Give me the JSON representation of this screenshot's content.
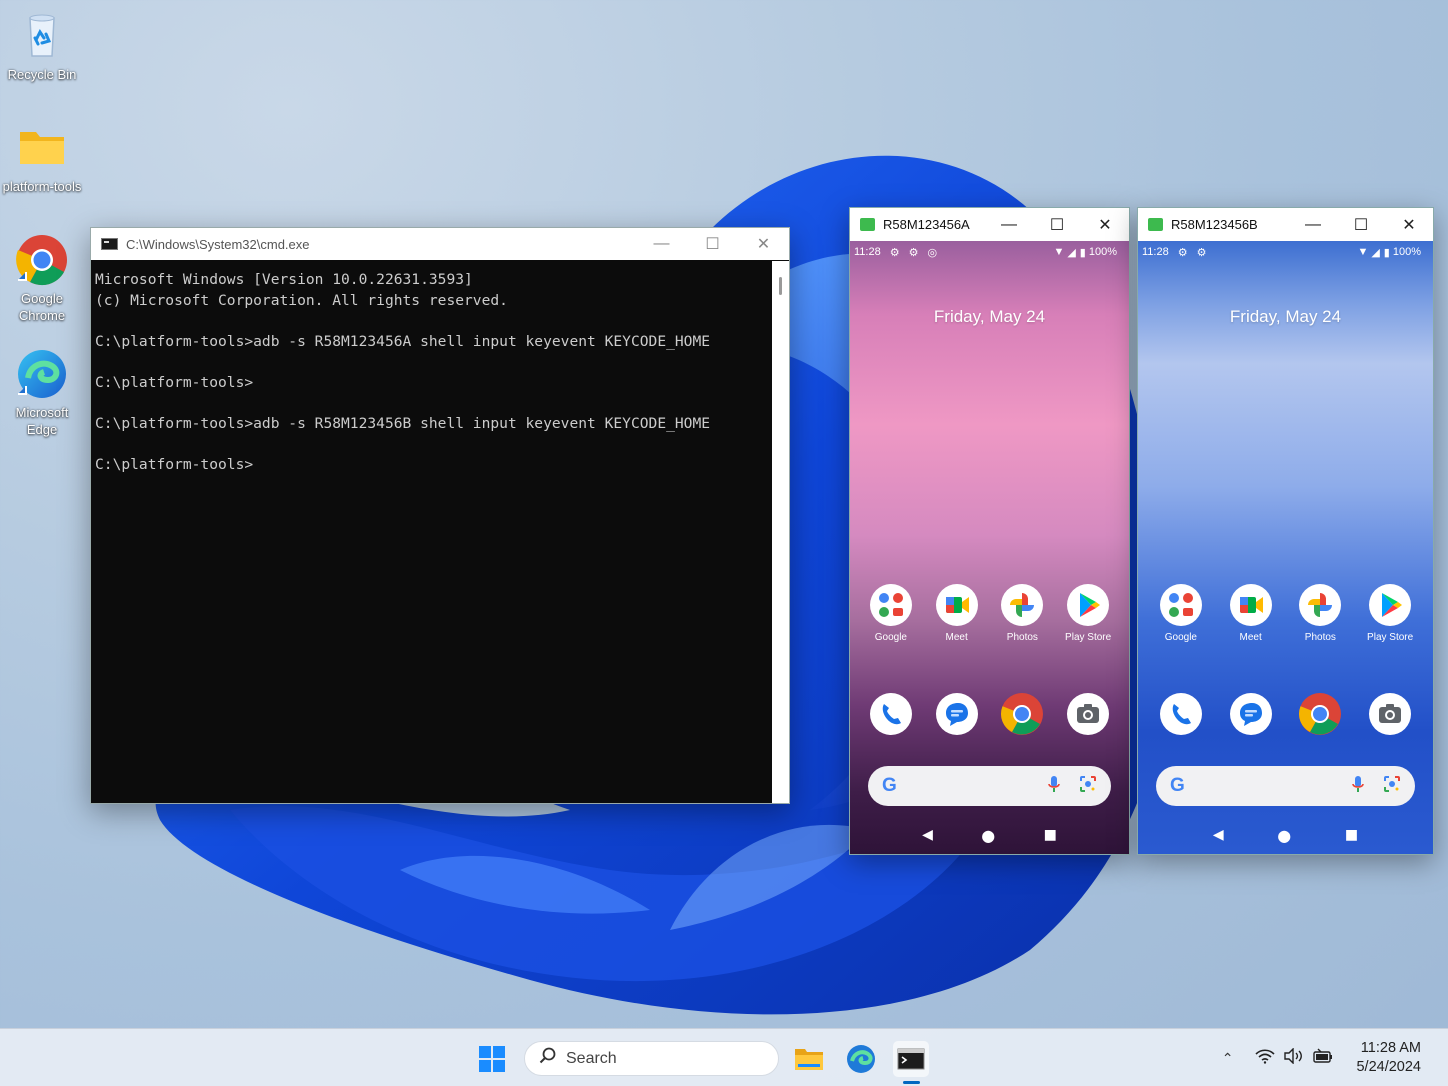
{
  "desktop": {
    "icons": [
      {
        "label": "Recycle Bin",
        "icon": "recycle-bin-icon"
      },
      {
        "label": "platform-tools",
        "icon": "folder-icon"
      },
      {
        "label": "Google Chrome",
        "icon": "chrome-icon"
      },
      {
        "label": "Microsoft Edge",
        "icon": "edge-icon"
      }
    ]
  },
  "cmd": {
    "title": "C:\\Windows\\System32\\cmd.exe",
    "lines": [
      "Microsoft Windows [Version 10.0.22631.3593]",
      "(c) Microsoft Corporation. All rights reserved.",
      "",
      "C:\\platform-tools>adb -s R58M123456A shell input keyevent KEYCODE_HOME",
      "",
      "C:\\platform-tools>",
      "",
      "C:\\platform-tools>adb -s R58M123456B shell input keyevent KEYCODE_HOME",
      "",
      "C:\\platform-tools>"
    ]
  },
  "phones": [
    {
      "title": "R58M123456A",
      "status": {
        "time": "11:28",
        "battery": "100%"
      },
      "date": "Friday, May 24",
      "apps": [
        {
          "label": "Google",
          "icon": "google-folder-icon"
        },
        {
          "label": "Meet",
          "icon": "meet-icon"
        },
        {
          "label": "Photos",
          "icon": "photos-icon"
        },
        {
          "label": "Play Store",
          "icon": "play-store-icon"
        }
      ],
      "dock": [
        "phone-icon",
        "messages-icon",
        "chrome-icon",
        "camera-icon"
      ],
      "search_logo": "G"
    },
    {
      "title": "R58M123456B",
      "status": {
        "time": "11:28",
        "battery": "100%"
      },
      "date": "Friday, May 24",
      "apps": [
        {
          "label": "Google",
          "icon": "google-folder-icon"
        },
        {
          "label": "Meet",
          "icon": "meet-icon"
        },
        {
          "label": "Photos",
          "icon": "photos-icon"
        },
        {
          "label": "Play Store",
          "icon": "play-store-icon"
        }
      ],
      "dock": [
        "phone-icon",
        "messages-icon",
        "chrome-icon",
        "camera-icon"
      ],
      "search_logo": "G"
    }
  ],
  "taskbar": {
    "search_placeholder": "Search",
    "time": "11:28 AM",
    "date": "5/24/2024"
  },
  "colors": {
    "accent": "#0067c0",
    "phoneA_wallpaper": "#ef98c4",
    "phoneB_wallpaper": "#3f6fd8",
    "console_bg": "#0c0c0c",
    "console_text": "#cccccc"
  }
}
